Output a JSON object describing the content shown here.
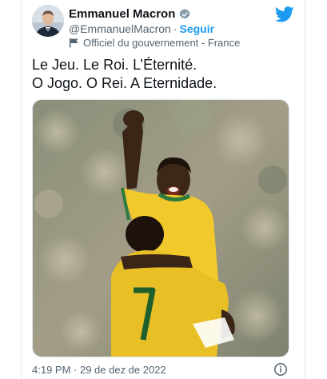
{
  "author": {
    "display_name": "Emmanuel Macron",
    "handle": "@EmmanuelMacron",
    "separator": "·",
    "follow_label": "Seguir",
    "affiliation": "Officiel du gouvernement - France",
    "verified_icon": "verified-badge-icon",
    "avatar_icon": "avatar"
  },
  "tweet": {
    "line1": "Le Jeu. Le Roi. L’Éternité.",
    "line2": "O Jogo. O Rei. A Eternidade."
  },
  "media": {
    "description_icon": "photo-celebration",
    "jersey_number": "7"
  },
  "footer": {
    "timestamp": "4:19 PM · 29 de dez de 2022",
    "info_icon": "info-icon"
  },
  "colors": {
    "brand": "#1d9bf0",
    "text": "#0f1419",
    "muted": "#536471",
    "jersey": "#f2c92c"
  }
}
